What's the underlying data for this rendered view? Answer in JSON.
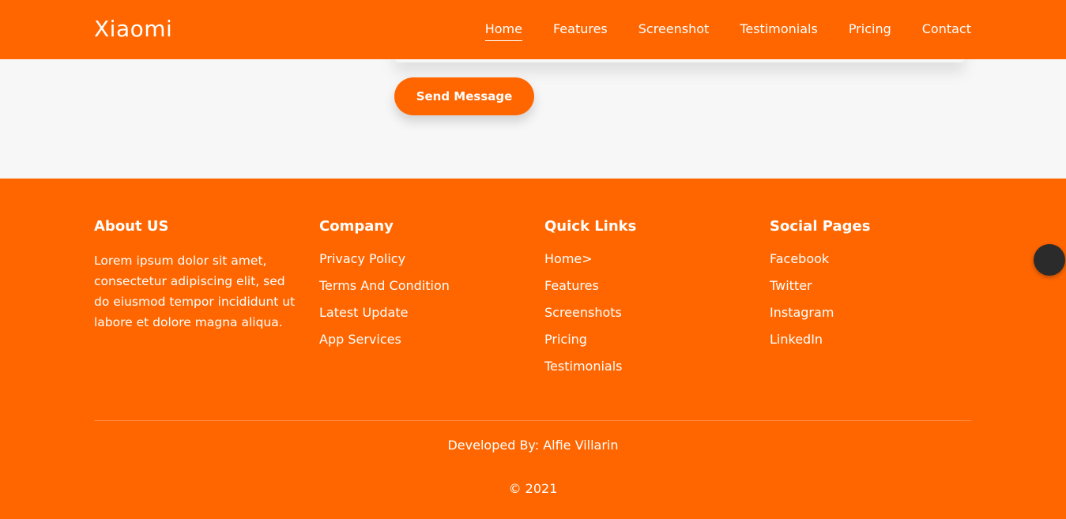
{
  "nav": {
    "brand": "Xiaomi",
    "links": [
      "Home",
      "Features",
      "Screenshot",
      "Testimonials",
      "Pricing",
      "Contact"
    ],
    "active": "Home"
  },
  "contact": {
    "send_label": "Send Message"
  },
  "footer": {
    "about": {
      "title": "About US",
      "text": "Lorem ipsum dolor sit amet, consectetur adipiscing elit, sed do eiusmod tempor incididunt ut labore et dolore magna aliqua."
    },
    "company": {
      "title": "Company",
      "items": [
        "Privacy Policy",
        "Terms And Condition",
        "Latest Update",
        "App Services"
      ]
    },
    "quick_links": {
      "title": "Quick Links",
      "items": [
        "Home>",
        "Features",
        "Screenshots",
        "Pricing",
        "Testimonials"
      ]
    },
    "social": {
      "title": "Social Pages",
      "items": [
        "Facebook",
        "Twitter",
        "Instagram",
        "LinkedIn"
      ]
    },
    "credit": "Developed By: Alfie Villarin",
    "copyright": "© 2021"
  },
  "colors": {
    "brand": "#ff6600",
    "background": "#f7f7f7",
    "scroll_button": "#2b2b2b"
  }
}
